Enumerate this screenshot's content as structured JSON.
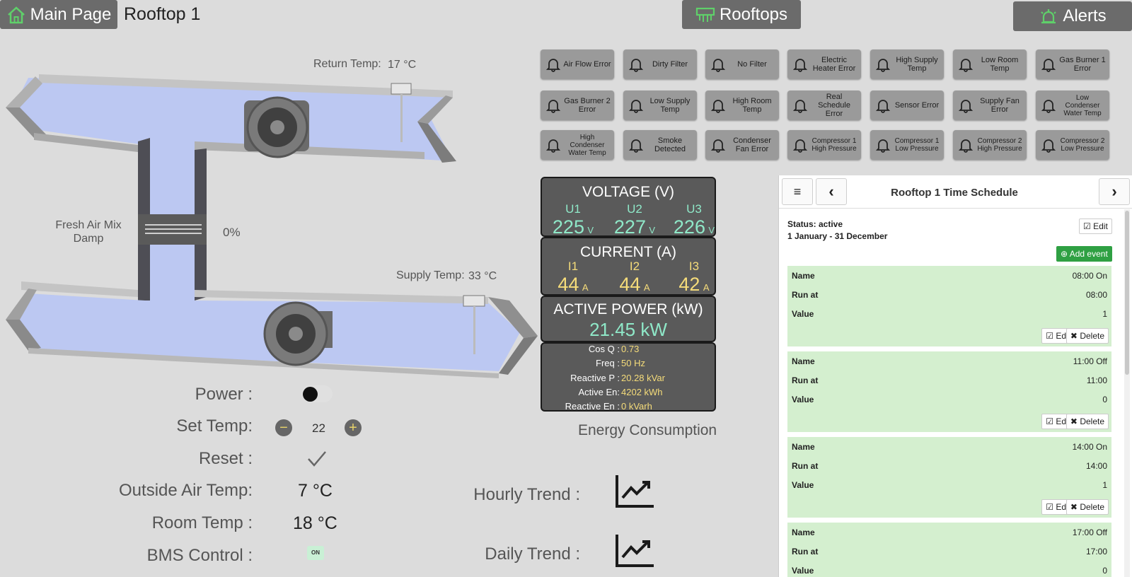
{
  "header": {
    "home_label": "Main Page",
    "page_title": "Rooftop 1",
    "rooftops_label": "Rooftops",
    "alerts_label": "Alerts"
  },
  "alarms": [
    [
      "Air Flow Error",
      "Dirty Filter",
      "No Filter",
      "Electric Heater Error",
      "High Supply Temp",
      "Low Room Temp",
      "Gas Burner 1 Error"
    ],
    [
      "Gas Burner 2 Error",
      "Low Supply Temp",
      "High Room Temp",
      "Real Schedule Error",
      "Sensor Error",
      "Supply Fan Error",
      "Low Condenser Water Temp"
    ],
    [
      "High Condenser Water Temp",
      "Smoke Detected",
      "Condenser Fan Error",
      "Compressor 1 High Pressure",
      "Compressor 1 Low Pressure",
      "Compressor 2 High Pressure",
      "Compressor 2 Low Pressure"
    ]
  ],
  "diagram": {
    "return_label": "Return Temp:",
    "return_value": "17 °C",
    "supply_label": "Supply Temp:",
    "supply_value": "33 °C",
    "damper_label": "Fresh Air Mix Damp",
    "damper_value": "0%"
  },
  "voltage": {
    "title": "VOLTAGE (V)",
    "phases": [
      {
        "label": "U1",
        "value": "225",
        "unit": "V"
      },
      {
        "label": "U2",
        "value": "227",
        "unit": "V"
      },
      {
        "label": "U3",
        "value": "226",
        "unit": "V"
      }
    ]
  },
  "current": {
    "title": "CURRENT (A)",
    "phases": [
      {
        "label": "I1",
        "value": "44",
        "unit": "A"
      },
      {
        "label": "I2",
        "value": "44",
        "unit": "A"
      },
      {
        "label": "I3",
        "value": "42",
        "unit": "A"
      }
    ]
  },
  "power": {
    "title": "ACTIVE POWER (kW)",
    "value": "21.45 kW"
  },
  "info": [
    {
      "k": "Cos Q :",
      "v": "0.73"
    },
    {
      "k": "Freq :",
      "v": "50 Hz"
    },
    {
      "k": "Reactive P :",
      "v": "20.28 kVar"
    },
    {
      "k": "Active En:",
      "v": "4202 kWh"
    },
    {
      "k": "Reactive En :",
      "v": "0 kVarh"
    }
  ],
  "energy_label": "Energy Consumption",
  "controls": {
    "power_label": "Power :",
    "settemp_label": "Set Temp:",
    "settemp_value": "22",
    "minus": "−",
    "plus": "+",
    "reset_label": "Reset :",
    "outside_label": "Outside Air Temp:",
    "outside_value": "7 °C",
    "room_label": "Room Temp :",
    "room_value": "18 °C",
    "bms_label": "BMS Control :",
    "bms_value": "ON"
  },
  "trends": {
    "hourly_label": "Hourly Trend :",
    "daily_label": "Daily Trend :"
  },
  "schedule": {
    "title": "Rooftop 1 Time Schedule",
    "menu_icon": "≡",
    "prev_icon": "‹",
    "next_icon": "›",
    "status": "Status: active",
    "range": "1 January - 31 December",
    "edit_label": "Edit",
    "add_label": "Add event",
    "delete_label": "Delete",
    "row_name": "Name",
    "row_run": "Run at",
    "row_value": "Value",
    "events": [
      {
        "name": "08:00 On",
        "run": "08:00",
        "value": "1"
      },
      {
        "name": "11:00 Off",
        "run": "11:00",
        "value": "0"
      },
      {
        "name": "14:00 On",
        "run": "14:00",
        "value": "1"
      },
      {
        "name": "17:00 Off",
        "run": "17:00",
        "value": "0"
      }
    ]
  }
}
